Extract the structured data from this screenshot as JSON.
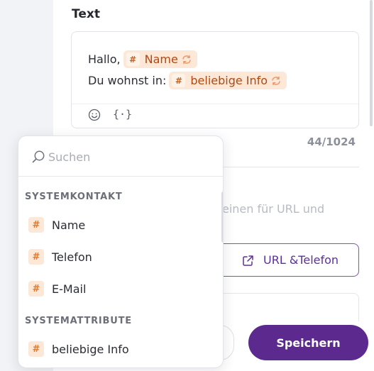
{
  "section": {
    "title": "Text"
  },
  "editor": {
    "line1_prefix": "Hallo,",
    "line1_chip": "Name",
    "line2_prefix": "Du wohnst in:",
    "line2_chip": "beliebige Info",
    "chip_symbol": "#",
    "toolbar": {
      "emoji_icon": "smiley-icon",
      "variable_label": "{·}"
    }
  },
  "counter": "44/1024",
  "hint_text": "einen für URL und",
  "buttons": {
    "url_phone": "URL &Telefon",
    "save": "Speichern"
  },
  "dropdown": {
    "search_placeholder": "Suchen",
    "groups": [
      {
        "label": "SYSTEMKONTAKT",
        "items": [
          "Name",
          "Telefon",
          "E-Mail"
        ]
      },
      {
        "label": "SYSTEMATTRIBUTE",
        "items": [
          "beliebige Info"
        ]
      }
    ],
    "item_symbol": "#"
  },
  "colors": {
    "accent_purple": "#5c2a8e",
    "chip_bg": "#fde8d8",
    "chip_text": "#b3480f",
    "hash_orange": "#e07a2e"
  }
}
